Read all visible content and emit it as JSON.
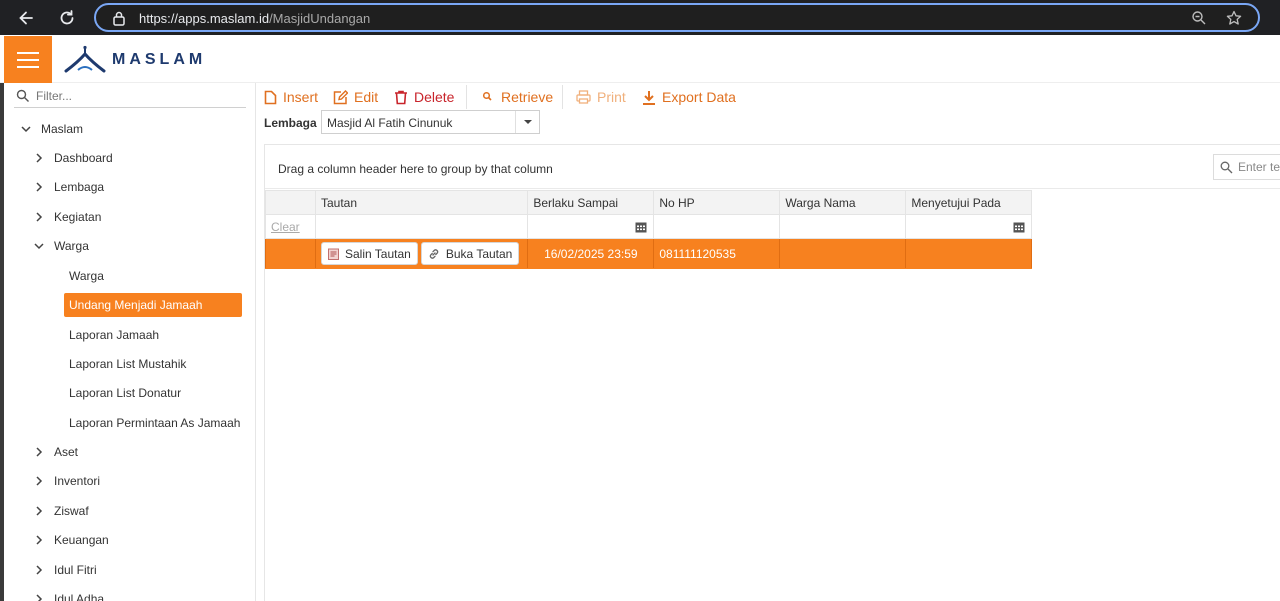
{
  "browser": {
    "url_host": "https://apps.maslam.id",
    "url_path": "/MasjidUndangan"
  },
  "header": {
    "logo_text": "MASLAM"
  },
  "sidebar": {
    "filter_placeholder": "Filter...",
    "items": [
      {
        "label": "Maslam",
        "expanded": true
      },
      {
        "label": "Dashboard"
      },
      {
        "label": "Lembaga"
      },
      {
        "label": "Kegiatan"
      },
      {
        "label": "Warga",
        "expanded": true
      },
      {
        "label": "Warga"
      },
      {
        "label": "Undang Menjadi Jamaah",
        "active": true
      },
      {
        "label": "Laporan Jamaah"
      },
      {
        "label": "Laporan List Mustahik"
      },
      {
        "label": "Laporan List Donatur"
      },
      {
        "label": "Laporan Permintaan As Jamaah"
      },
      {
        "label": "Aset"
      },
      {
        "label": "Inventori"
      },
      {
        "label": "Ziswaf"
      },
      {
        "label": "Keuangan"
      },
      {
        "label": "Idul Fitri"
      },
      {
        "label": "Idul Adha"
      }
    ]
  },
  "toolbar": {
    "insert": "Insert",
    "edit": "Edit",
    "delete": "Delete",
    "retrieve": "Retrieve",
    "print": "Print",
    "export": "Export Data"
  },
  "filter": {
    "lembaga_label": "Lembaga",
    "lembaga_value": "Masjid Al Fatih Cinunuk"
  },
  "grid": {
    "group_hint": "Drag a column header here to group by that column",
    "search_placeholder": "Enter text to search...",
    "columns": [
      "",
      "Tautan",
      "Berlaku Sampai",
      "No HP",
      "Warga Nama",
      "Menyetujui Pada"
    ],
    "clear_label": "Clear",
    "rows": [
      {
        "copy_label": "Salin Tautan",
        "open_label": "Buka Tautan",
        "berlaku_sampai": "16/02/2025 23:59",
        "no_hp": "081111120535",
        "warga_nama": "",
        "menyetujui_pada": ""
      }
    ]
  },
  "colors": {
    "accent": "#f7811f",
    "delete": "#c8242b",
    "brand_navy": "#1e3a6e"
  }
}
